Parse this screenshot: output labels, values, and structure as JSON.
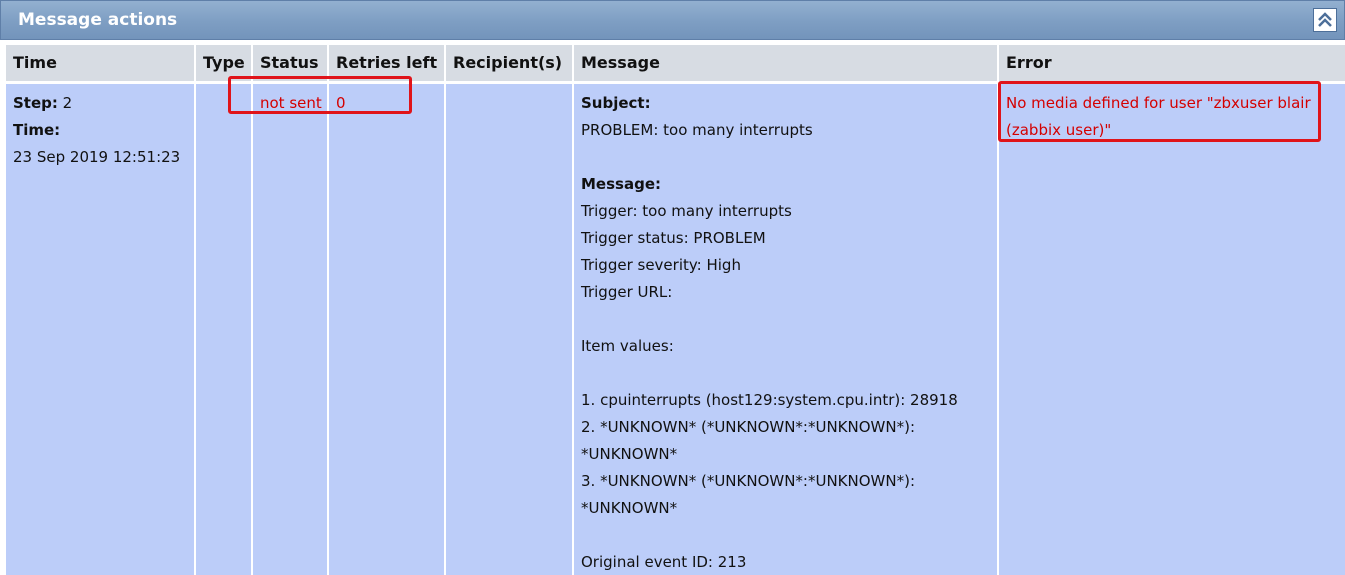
{
  "panel": {
    "title": "Message actions",
    "collapse_icon": "double-chevron-up-icon"
  },
  "columns": {
    "time": "Time",
    "type": "Type",
    "status": "Status",
    "retries": "Retries left",
    "recipients": "Recipient(s)",
    "message": "Message",
    "error": "Error"
  },
  "row": {
    "step_label": "Step:",
    "step_value": "2",
    "time_label": "Time:",
    "time_value": "23 Sep 2019 12:51:23",
    "type": "",
    "status": "not sent",
    "retries": "0",
    "recipients": "",
    "message": {
      "subject_label": "Subject:",
      "subject": "PROBLEM: too many interrupts",
      "message_label": "Message:",
      "lines": [
        "Trigger: too many interrupts",
        "Trigger status: PROBLEM",
        "Trigger severity: High",
        "Trigger URL:",
        "",
        "Item values:",
        "",
        "1. cpuinterrupts (host129:system.cpu.intr): 28918",
        "2. *UNKNOWN* (*UNKNOWN*:*UNKNOWN*):",
        "*UNKNOWN*",
        "3. *UNKNOWN* (*UNKNOWN*:*UNKNOWN*):",
        "*UNKNOWN*",
        "",
        "Original event ID: 213"
      ]
    },
    "error_lines": [
      "No media defined for user \"zbxuser blair",
      "(zabbix user)\""
    ]
  },
  "colors": {
    "header_bg": "#7e9ec3",
    "column_header_bg": "#d7dce3",
    "cell_bg": "#bccdf9",
    "error_text": "#d40000",
    "highlight_box": "#e0141a"
  }
}
